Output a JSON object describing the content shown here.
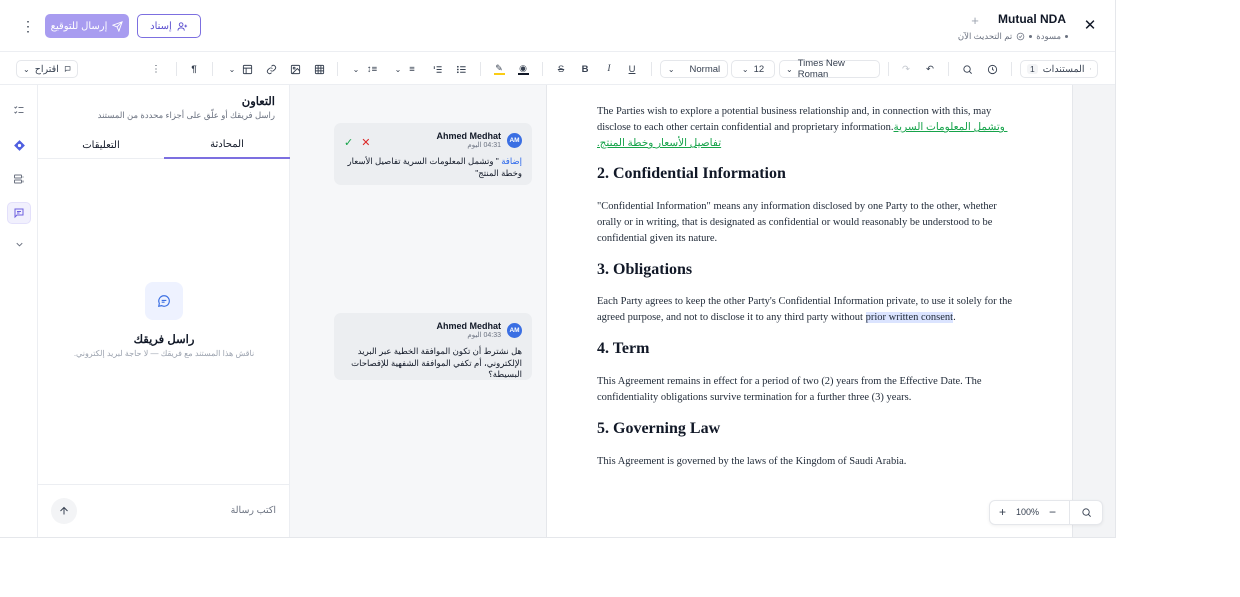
{
  "header": {
    "title": "Mutual NDA",
    "status_draft": "مسودة",
    "status_updated": "تم التحديث الآن",
    "send_for_signature": "إرسال للتوقيع",
    "assign": "إسناد"
  },
  "toolbar": {
    "documents_label": "المستندات",
    "documents_count": "1",
    "font_family": "Times New Roman",
    "font_size": "12",
    "style": "Normal",
    "suggest_label": "اقتراح"
  },
  "collab": {
    "title": "التعاون",
    "subtitle": "راسل فريقك أو علّق على أجزاء محددة من المستند",
    "tabs": [
      "المحادثة",
      "التعليقات"
    ],
    "active_tab": 0,
    "empty_title": "راسل فريقك",
    "empty_subtitle": "ناقش هذا المستند مع فريقك — لا حاجة لبريد إلكتروني.",
    "composer_placeholder": "اكتب رسالة"
  },
  "comments": [
    {
      "initials": "AM",
      "author": "Ahmed Medhat",
      "time": "04:31 اليوم",
      "prefix": "إضافة",
      "text": "\" وتشمل المعلومات السرية تفاصيل الأسعار وخطة المنتج\""
    },
    {
      "initials": "AM",
      "author": "Ahmed Medhat",
      "time": "04:33 اليوم",
      "prefix": "",
      "text": "هل نشترط أن تكون الموافقة الخطية عبر البريد الإلكتروني، أم تكفي الموافقة الشفهية للإفصاحات البسيطة؟"
    }
  ],
  "document": {
    "intro_text": "The Parties wish to explore a potential business relationship and, in connection with this, may disclose to each other certain confidential and proprietary information.",
    "intro_insert": " وتشمل المعلومات السرية تفاصيل الأسعار وخطة المنتج.",
    "s2_heading": "2. Confidential Information",
    "s2_text": "\"Confidential Information\" means any information disclosed by one Party to the other, whether orally or in writing, that is designated as confidential or would reasonably be understood to be confidential given its nature.",
    "s3_heading": "3. Obligations",
    "s3_text_before": "Each Party agrees to keep the other Party's Confidential Information private, to use it solely for the agreed purpose, and not to disclose it to any third party without ",
    "s3_highlight": "prior written consent",
    "s3_text_after": ".",
    "s4_heading": "4. Term",
    "s4_text": "This Agreement remains in effect for a period of two (2) years from the Effective Date. The confidentiality obligations survive termination for a further three (3) years.",
    "s5_heading": "5. Governing Law",
    "s5_text": "This Agreement is governed by the laws of the Kingdom of Saudi Arabia."
  },
  "zoom": {
    "level": "100%"
  },
  "colors": {
    "accent": "#7c6fe0",
    "insert": "#16a34a",
    "highlight": "#dbe4ff",
    "avatar": "#3b6fe3"
  }
}
